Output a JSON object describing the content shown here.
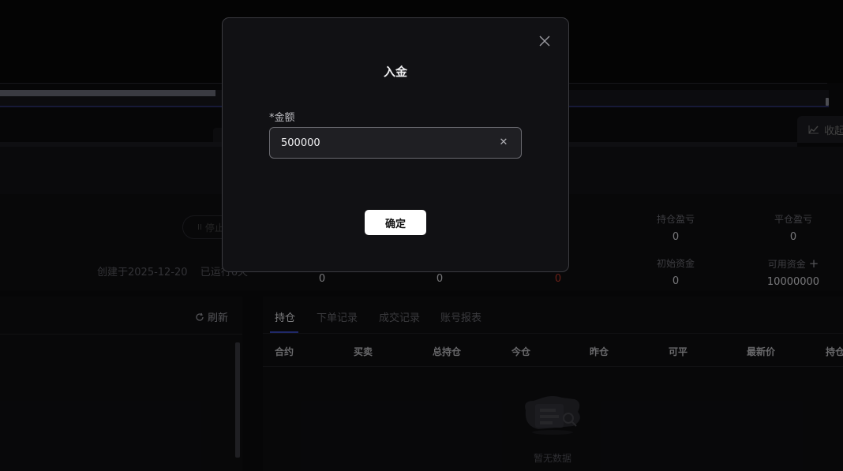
{
  "background": {
    "created_text": "创建于2025-12-20",
    "running_text": "已运行6天",
    "stop_label": "停止",
    "collapse_label": "收起",
    "stats_row1": [
      {
        "label": "持仓盈亏",
        "value": "0"
      },
      {
        "label": "平仓盈亏",
        "value": "0"
      }
    ],
    "stats_row2": [
      {
        "label": "",
        "value": "0"
      },
      {
        "label": "",
        "value": "0"
      },
      {
        "label": "",
        "value": "0",
        "red": true
      },
      {
        "label": "初始资金",
        "value": "0"
      },
      {
        "label": "可用资金",
        "value": "10000000"
      }
    ],
    "refresh_label": "刷新",
    "tabs": [
      "持仓",
      "下单记录",
      "成交记录",
      "账号报表"
    ],
    "active_tab": "持仓",
    "table_headers": [
      "合约",
      "买卖",
      "总持仓",
      "今仓",
      "昨仓",
      "可平",
      "最新价",
      "持仓"
    ],
    "empty_text": "暂无数据",
    "progress_fraction": 0.26
  },
  "modal": {
    "title": "入金",
    "amount_label": "*金额",
    "amount_value": "500000",
    "confirm_label": "确定"
  },
  "colors": {
    "accent_tab": "#3b4cc0",
    "loss_red": "#c0392b"
  }
}
